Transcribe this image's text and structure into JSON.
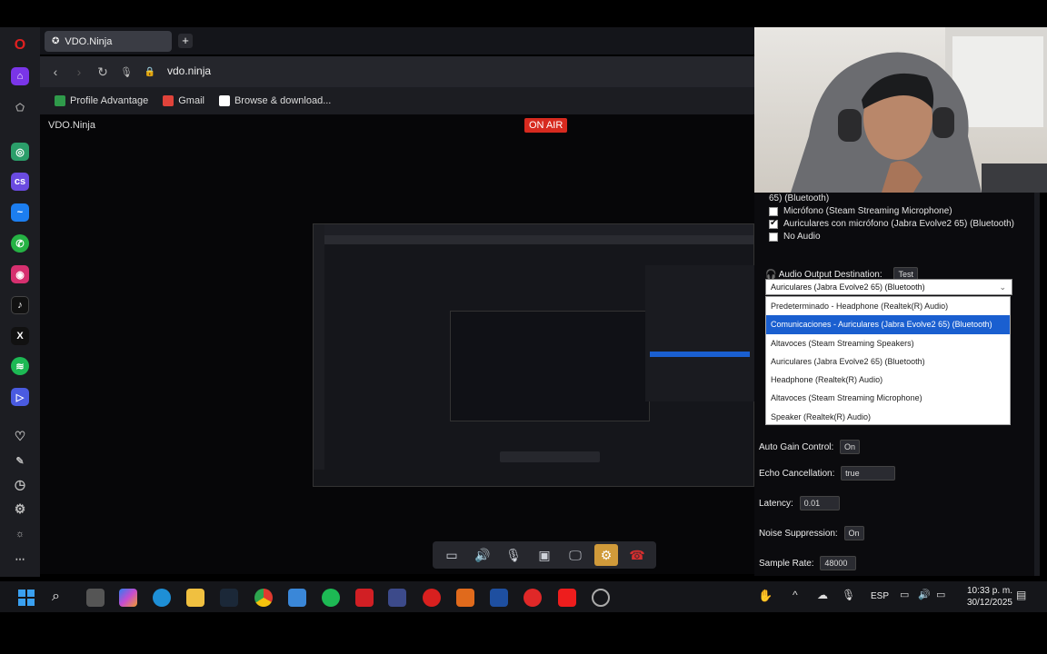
{
  "browser": {
    "tab_title": "VDO.Ninja",
    "address": "vdo.ninja",
    "bookmarks": [
      "Profile Advantage",
      "Gmail",
      "Browse & download..."
    ]
  },
  "page": {
    "site_title": "VDO.Ninja",
    "on_air": "ON AIR"
  },
  "settings": {
    "mic_partial": "65) (Bluetooth)",
    "audio_sources": [
      {
        "label": "Micrófono (Steam Streaming Microphone)",
        "checked": false
      },
      {
        "label": "Auriculares con micrófono (Jabra Evolve2 65) (Bluetooth)",
        "checked": true
      },
      {
        "label": "No Audio",
        "checked": false
      }
    ],
    "output_label": "Audio Output Destination:",
    "test_button": "Test",
    "output_selected": "Auriculares (Jabra Evolve2 65) (Bluetooth)",
    "output_options": [
      "Predeterminado - Headphone (Realtek(R) Audio)",
      "Comunicaciones - Auriculares (Jabra Evolve2 65) (Bluetooth)",
      "Altavoces (Steam Streaming Speakers)",
      "Auriculares (Jabra Evolve2 65) (Bluetooth)",
      "Headphone (Realtek(R) Audio)",
      "Altavoces (Steam Streaming Microphone)",
      "Speaker (Realtek(R) Audio)"
    ],
    "highlighted_option_index": 1,
    "auto_gain_label": "Auto Gain Control:",
    "auto_gain_value": "On",
    "echo_label": "Echo Cancellation:",
    "echo_value": "true",
    "latency_label": "Latency:",
    "latency_value": "0.01",
    "noise_label": "Noise Suppression:",
    "noise_value": "On",
    "sample_label": "Sample Rate:",
    "sample_value": "48000"
  },
  "taskbar": {
    "language": "ESP",
    "time": "10:33 p. m.",
    "date": "30/12/2025"
  },
  "colors": {
    "on_air": "#d72a1f",
    "highlight": "#1a5fd0",
    "active_control": "#d09a3a"
  }
}
